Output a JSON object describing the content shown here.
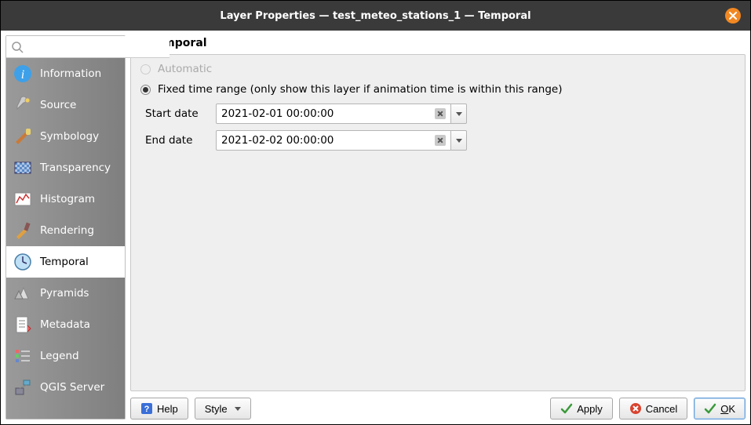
{
  "window": {
    "title": "Layer Properties — test_meteo_stations_1 — Temporal"
  },
  "search": {
    "placeholder": ""
  },
  "sidebar": {
    "items": [
      {
        "label": "Information"
      },
      {
        "label": "Source"
      },
      {
        "label": "Symbology"
      },
      {
        "label": "Transparency"
      },
      {
        "label": "Histogram"
      },
      {
        "label": "Rendering"
      },
      {
        "label": "Temporal"
      },
      {
        "label": "Pyramids"
      },
      {
        "label": "Metadata"
      },
      {
        "label": "Legend"
      },
      {
        "label": "QGIS Server"
      }
    ],
    "active_index": 6
  },
  "panel": {
    "title": "Temporal",
    "enabled": true,
    "options": {
      "automatic": {
        "label": "Automatic",
        "selected": false,
        "disabled": true
      },
      "fixed": {
        "label": "Fixed time range (only show this layer if animation time is within this range)",
        "selected": true
      }
    },
    "start": {
      "label": "Start date",
      "value": "2021-02-01 00:00:00"
    },
    "end": {
      "label": "End date",
      "value": "2021-02-02 00:00:00"
    }
  },
  "buttons": {
    "help": "Help",
    "style": "Style",
    "apply": "Apply",
    "cancel": "Cancel",
    "ok": "OK"
  }
}
